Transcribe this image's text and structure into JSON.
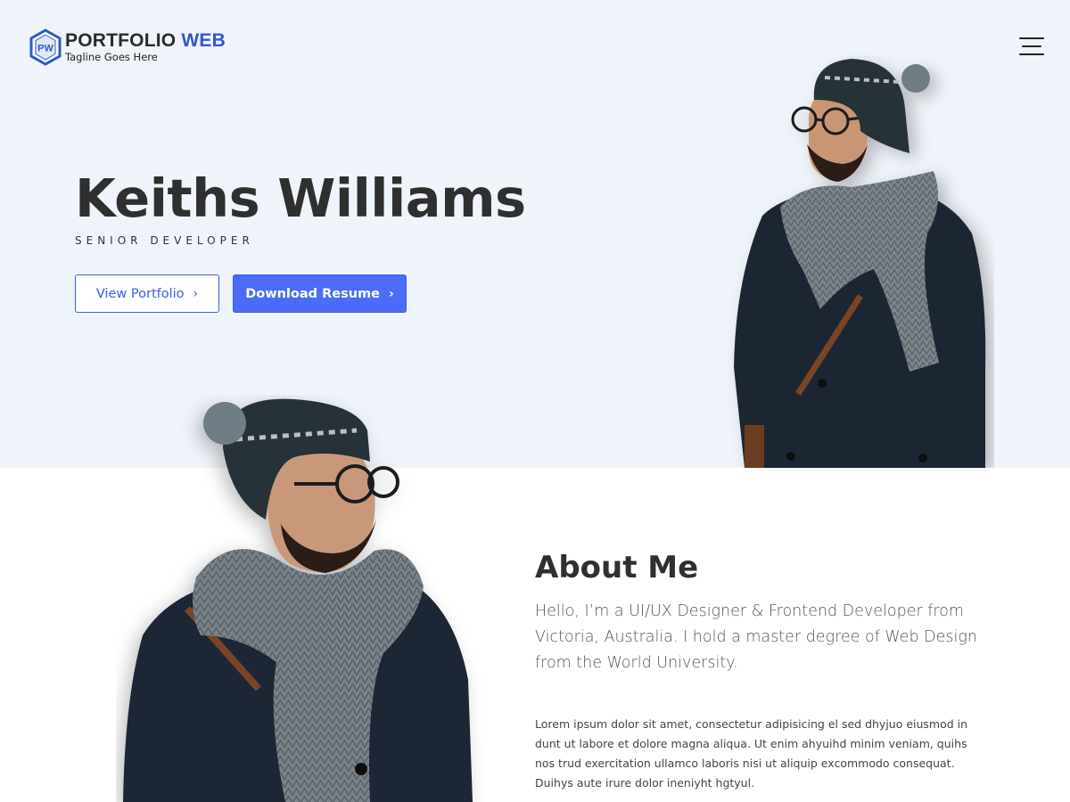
{
  "brand": {
    "mark_text": "PW",
    "title_main": "PORTFOLIO",
    "title_accent": "WEB",
    "tagline": "Tagline Goes Here",
    "accent_color": "#2f58c9"
  },
  "nav": {
    "menu_icon": "hamburger-menu-icon"
  },
  "hero": {
    "name": "Keiths Williams",
    "role": "SENIOR DEVELOPER",
    "buttons": {
      "portfolio_label": "View Portfolio",
      "resume_label": "Download Resume",
      "chevron": "›"
    },
    "background_color": "#eff4fa",
    "primary_color": "#4a6cf7"
  },
  "about": {
    "title": "About Me",
    "lead": "Hello, I’m a UI/UX Designer & Frontend Developer from Victoria, Australia. I hold a master degree of Web Design from the World University.",
    "body": "Lorem ipsum dolor sit amet, consectetur adipisicing el sed dhyjuo eiusmod in dunt ut labore et dolore magna aliqua. Ut enim ahyuihd minim veniam, quihs nos trud exercitation ullamco laboris nisi ut aliquip excommodo consequat. Duihys aute irure dolor ineniyht hgtyul."
  }
}
